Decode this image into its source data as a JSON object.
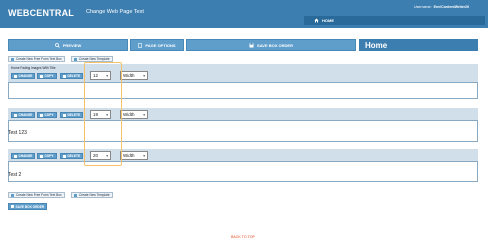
{
  "header": {
    "logo": "WEBCENTRAL",
    "page_title": "Change Web Page Text",
    "username_label": "Username:",
    "username_value": "Env\\ContentWriter20",
    "nav_home": "HOME"
  },
  "toolbar": {
    "preview": "PREVIEW",
    "page_options": "PAGE OPTIONS",
    "save_box_order": "SAVE BOX ORDER",
    "page_name": "Home"
  },
  "links": {
    "create_free_form": "Create New Free Form Text Box",
    "create_template": "Create New Template"
  },
  "panels": [
    {
      "title": "Home Fading Images With Title",
      "order": "12",
      "width": "Width",
      "text": ""
    },
    {
      "title": "",
      "order": "19",
      "width": "Width",
      "text": "Test 123"
    },
    {
      "title": "",
      "order": "20",
      "width": "Width",
      "text": "Test 2"
    }
  ],
  "actions": {
    "change": "CHANGE",
    "copy": "COPY",
    "delete": "DELETE"
  },
  "bottom": {
    "save_box_order": "SAVE BOX ORDER"
  },
  "footer": {
    "back_to_top": "BACK TO TOP"
  }
}
